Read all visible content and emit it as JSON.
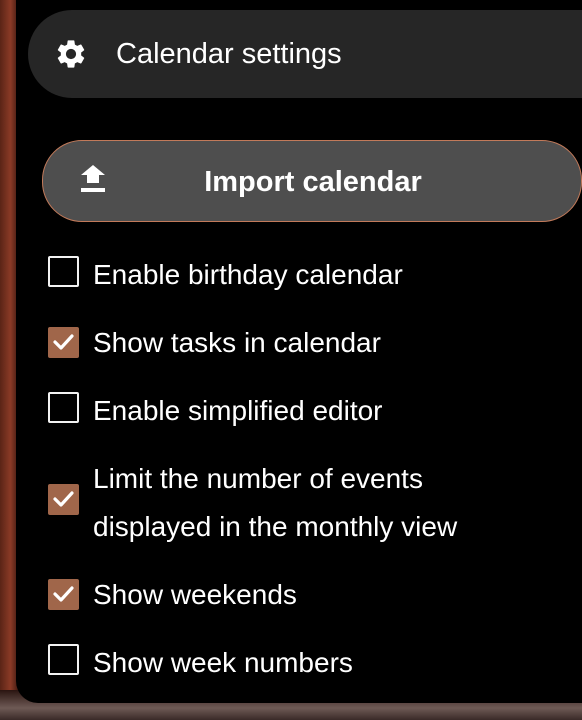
{
  "menu": {
    "settings_label": "Calendar settings",
    "settings_icon": "gear-icon",
    "import_label": "Import calendar",
    "import_icon": "upload-icon"
  },
  "options": [
    {
      "label": "Enable birthday calendar",
      "checked": false
    },
    {
      "label": "Show tasks in calendar",
      "checked": true
    },
    {
      "label": "Enable simplified editor",
      "checked": false
    },
    {
      "label_line1": "Limit the number of events",
      "label_line2": "displayed in the monthly view",
      "checked": true
    },
    {
      "label": "Show weekends",
      "checked": true
    },
    {
      "label": "Show week numbers",
      "checked": false
    }
  ],
  "colors": {
    "accent": "#a0664a",
    "button_border": "#c27a5a",
    "panel": "#000000",
    "pill": "#262626",
    "button": "#4e4e4e"
  }
}
